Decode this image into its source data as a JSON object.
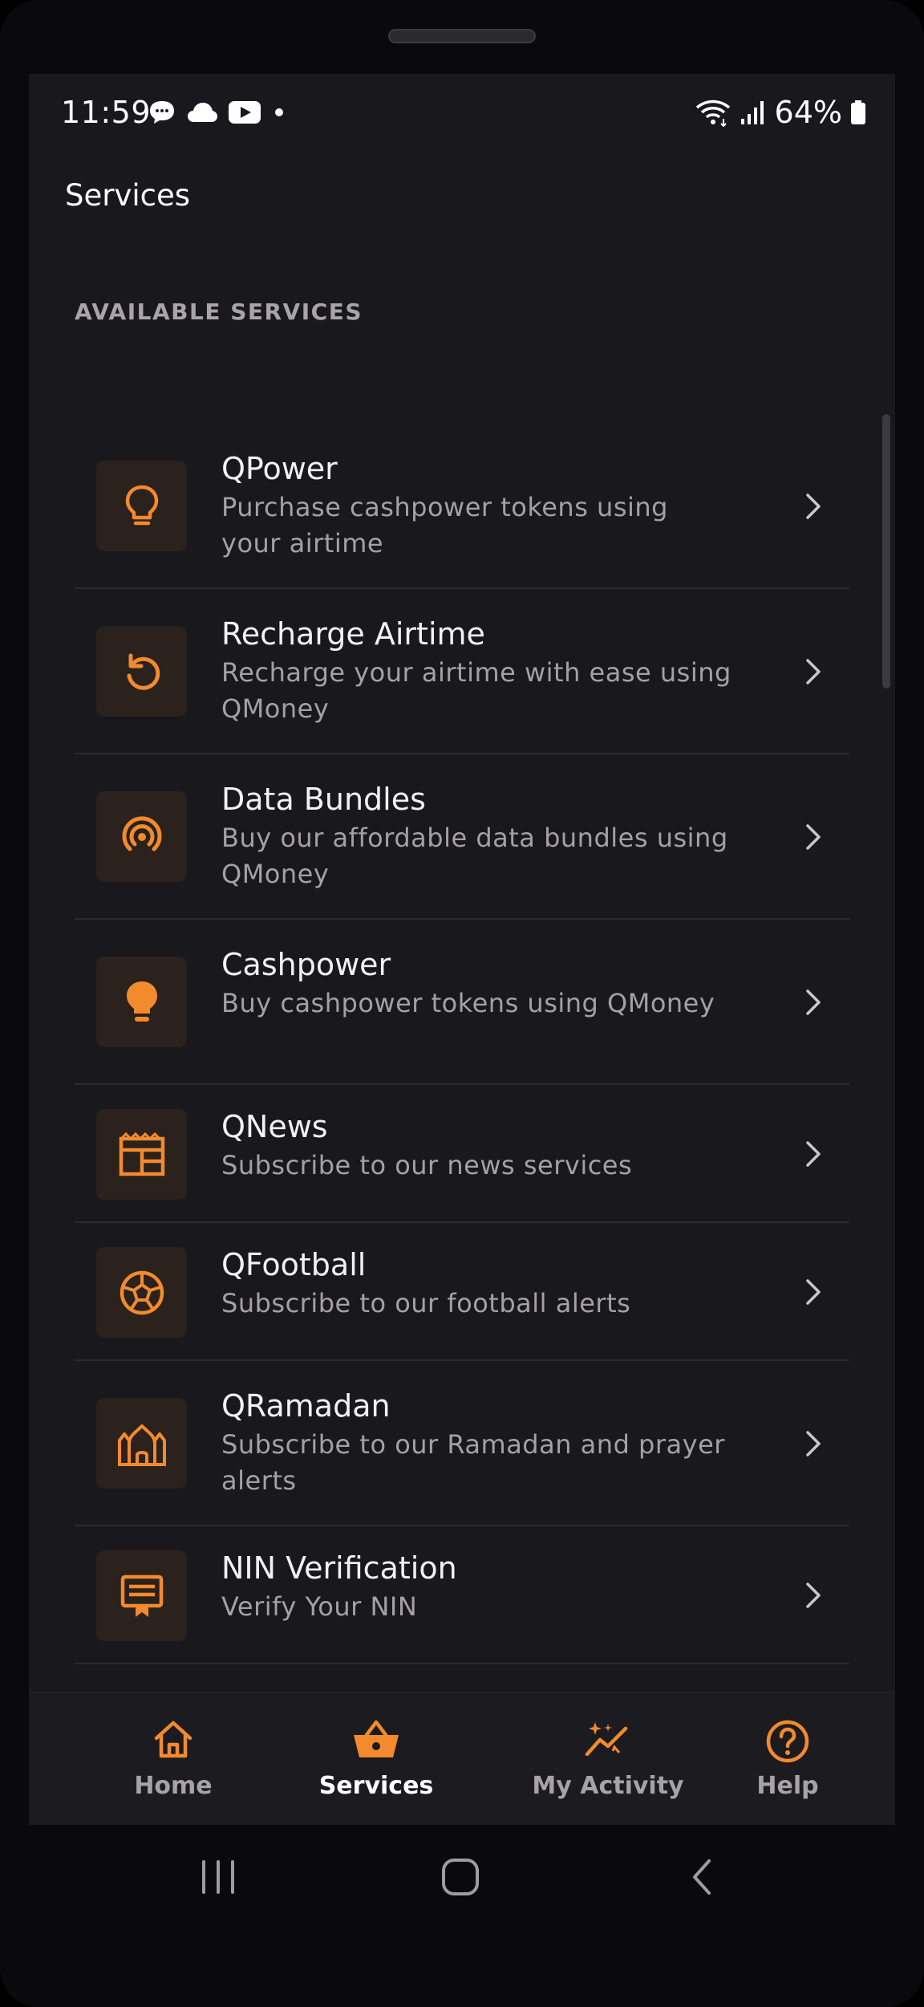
{
  "status_bar": {
    "time": "11:59",
    "battery": "64%",
    "left_icons": [
      "chat-bubble-icon",
      "cloud-icon",
      "youtube-icon",
      "dot-icon"
    ],
    "right_icons": [
      "wifi-icon",
      "signal-icon",
      "battery-icon"
    ]
  },
  "header": {
    "title": "Services"
  },
  "section": {
    "label": "AVAILABLE SERVICES"
  },
  "services": [
    {
      "title": "QPower",
      "subtitle": "Purchase cashpower tokens using your airtime",
      "icon": "lightbulb-outline-icon"
    },
    {
      "title": "Recharge Airtime",
      "subtitle": "Recharge your airtime with ease using QMoney",
      "icon": "refresh-icon"
    },
    {
      "title": "Data Bundles",
      "subtitle": "Buy our affordable data bundles using QMoney",
      "icon": "broadcast-icon"
    },
    {
      "title": "Cashpower",
      "subtitle": "Buy cashpower tokens using QMoney",
      "icon": "lightbulb-filled-icon"
    },
    {
      "title": "QNews",
      "subtitle": "Subscribe to our news services",
      "icon": "newspaper-icon"
    },
    {
      "title": "QFootball",
      "subtitle": "Subscribe to our football alerts",
      "icon": "football-icon"
    },
    {
      "title": "QRamadan",
      "subtitle": "Subscribe to our Ramadan and prayer alerts",
      "icon": "mosque-icon"
    },
    {
      "title": "NIN Verification",
      "subtitle": "Verify Your NIN",
      "icon": "id-badge-icon"
    }
  ],
  "bottom_nav": [
    {
      "label": "Home",
      "icon": "home-icon",
      "active": false
    },
    {
      "label": "Services",
      "icon": "basket-icon",
      "active": true
    },
    {
      "label": "My Activity",
      "icon": "activity-icon",
      "active": false
    },
    {
      "label": "Help",
      "icon": "help-icon",
      "active": false
    }
  ],
  "colors": {
    "accent": "#f28a2e",
    "background": "#19181d",
    "icon_tile": "#2b211d"
  }
}
